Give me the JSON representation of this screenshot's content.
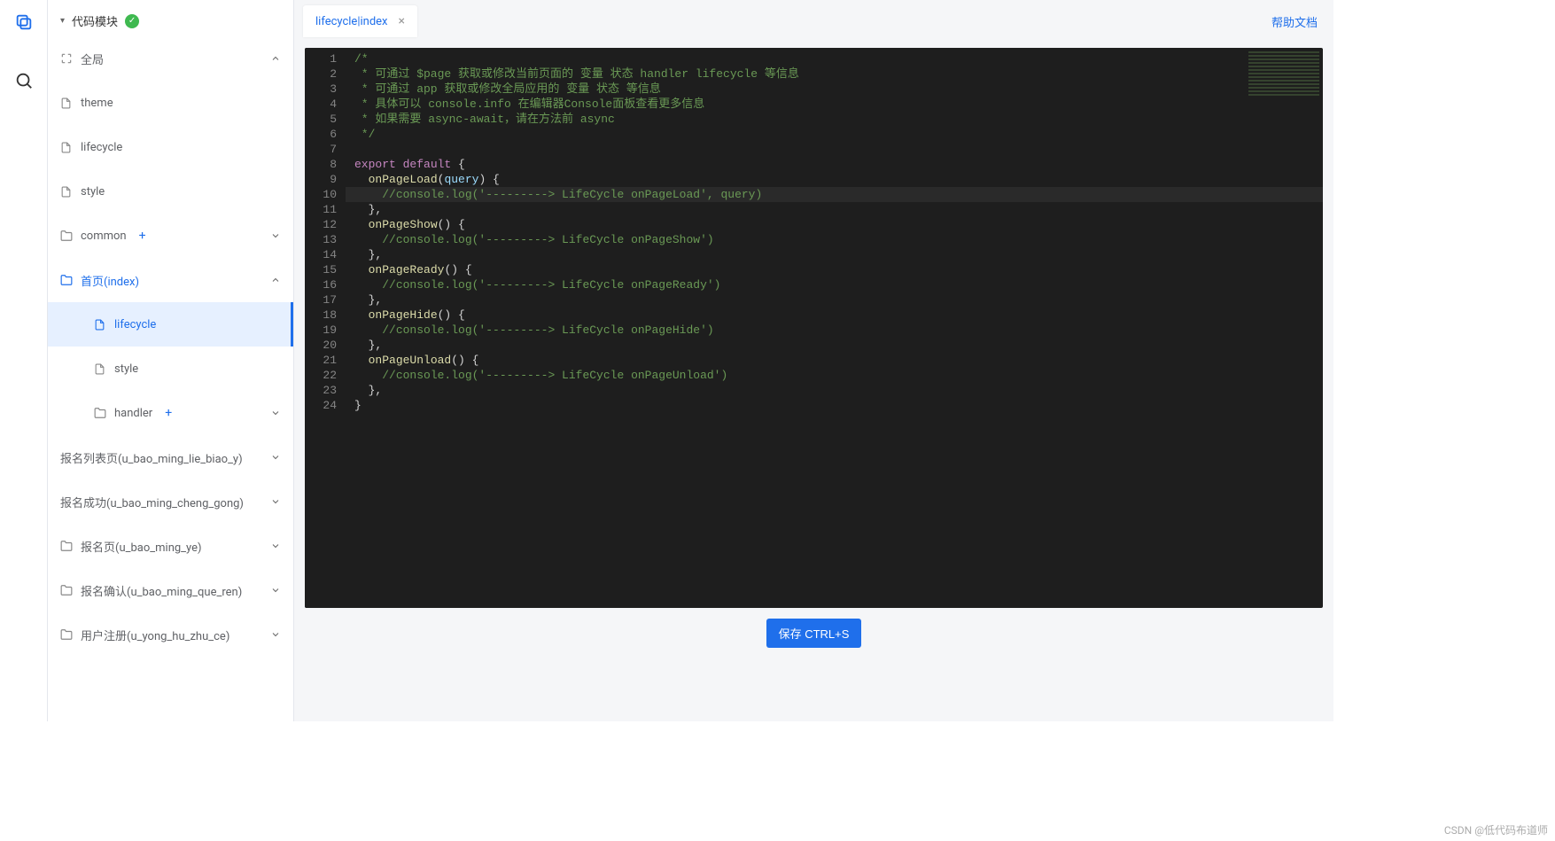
{
  "rail": {
    "item1": "copy",
    "item2": "search"
  },
  "header": {
    "title": "代码模块"
  },
  "sidebar": {
    "global": "全局",
    "theme": "theme",
    "lifecycle_global": "lifecycle",
    "style_global": "style",
    "common": "common",
    "home": "首页(index)",
    "lifecycle": "lifecycle",
    "style": "style",
    "handler": "handler",
    "page_list": "报名列表页(u_bao_ming_lie_biao_y)",
    "page_success": "报名成功(u_bao_ming_cheng_gong)",
    "page_reg": "报名页(u_bao_ming_ye)",
    "page_confirm": "报名确认(u_bao_ming_que_ren)",
    "page_user": "用户注册(u_yong_hu_zhu_ce)"
  },
  "tab": {
    "name": "lifecycle|index"
  },
  "help": "帮助文档",
  "save": "保存 CTRL+S",
  "watermark": "CSDN @低代码布道师",
  "code": {
    "l1": "/*",
    "l2": " * 可通过 $page 获取或修改当前页面的 变量 状态 handler lifecycle 等信息",
    "l3": " * 可通过 app 获取或修改全局应用的 变量 状态 等信息",
    "l4": " * 具体可以 console.info 在编辑器Console面板查看更多信息",
    "l5": " * 如果需要 async-await，请在方法前 async",
    "l6": " */",
    "l8a": "export",
    "l8b": "default",
    "l8c": "{",
    "l9a": "onPageLoad",
    "l9b": "(",
    "l9c": "query",
    "l9d": ") {",
    "l10": "//console.log('---------> LifeCycle onPageLoad', query)",
    "l11": "},",
    "l12a": "onPageShow",
    "l12b": "() {",
    "l13": "//console.log('---------> LifeCycle onPageShow')",
    "l14": "},",
    "l15a": "onPageReady",
    "l15b": "() {",
    "l16": "//console.log('---------> LifeCycle onPageReady')",
    "l17": "},",
    "l18a": "onPageHide",
    "l18b": "() {",
    "l19": "//console.log('---------> LifeCycle onPageHide')",
    "l20": "},",
    "l21a": "onPageUnload",
    "l21b": "() {",
    "l22": "//console.log('---------> LifeCycle onPageUnload')",
    "l23": "},",
    "l24": "}"
  }
}
